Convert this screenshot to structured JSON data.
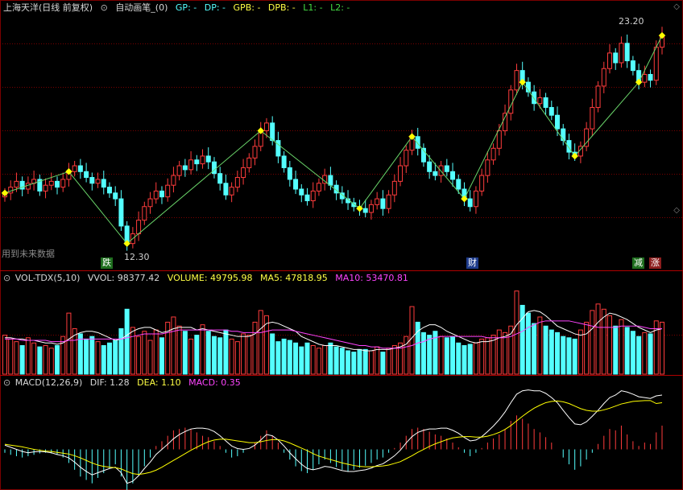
{
  "header": {
    "title": "上海天洋(日线 前复权)",
    "indicator": "自动画笔_(0)",
    "gp": "GP: -",
    "dp": "DP: -",
    "gpb": "GPB: -",
    "dpb": "DPB: -",
    "l1": "L1: -",
    "l2": "L2: -"
  },
  "price_panel": {
    "high_label": "23.20",
    "low_label": "12.30",
    "future_note": "用到未来数据",
    "markers": [
      {
        "text": "跌",
        "bg": "#1e6e1e"
      },
      {
        "text": "财",
        "bg": "#1e3c8c"
      },
      {
        "text": "减",
        "bg": "#1e6e1e"
      },
      {
        "text": "涨",
        "bg": "#8c1e1e"
      }
    ]
  },
  "volume_panel": {
    "name": "VOL-TDX(5,10)",
    "vvol": "VVOL: 98377.42",
    "volume": "VOLUME: 49795.98",
    "ma5": "MA5: 47818.95",
    "ma10": "MA10: 53470.81"
  },
  "macd_panel": {
    "name": "MACD(12,26,9)",
    "dif": "DIF: 1.28",
    "dea": "DEA: 1.10",
    "macd": "MACD: 0.35"
  },
  "colors": {
    "up": "#ff3c3c",
    "down": "#54ffff",
    "zigzag": "#6ad56a",
    "pivot": "#ffff00",
    "ma5": "#ffffff",
    "ma10": "#ff44ff",
    "dif": "#ffffff",
    "dea": "#ffff00",
    "grid": "#7a0000"
  },
  "chart_data": [
    {
      "type": "candlestick",
      "title": "上海天洋(日线 前复权)",
      "ylim": [
        11.5,
        24.0
      ],
      "closes": [
        14.9,
        15.2,
        15.5,
        15.1,
        15.4,
        15.6,
        15.0,
        15.3,
        15.5,
        15.2,
        15.6,
        16.0,
        16.3,
        16.0,
        15.7,
        15.4,
        15.6,
        15.2,
        14.9,
        14.6,
        13.2,
        12.3,
        12.8,
        13.5,
        14.2,
        14.6,
        15.0,
        14.7,
        15.3,
        15.8,
        16.3,
        16.1,
        16.6,
        16.4,
        16.8,
        16.5,
        15.9,
        15.4,
        14.8,
        15.2,
        15.7,
        16.2,
        16.7,
        17.3,
        18.1,
        18.5,
        17.6,
        16.8,
        16.2,
        15.6,
        15.1,
        14.8,
        14.5,
        15.0,
        15.4,
        15.8,
        15.3,
        14.9,
        14.6,
        14.4,
        14.2,
        14.1,
        13.9,
        14.3,
        14.6,
        14.1,
        14.8,
        15.5,
        16.3,
        17.1,
        17.8,
        17.2,
        16.5,
        16.0,
        15.8,
        16.3,
        16.0,
        15.6,
        15.1,
        14.6,
        14.2,
        15.0,
        15.8,
        16.6,
        17.2,
        18.1,
        19.0,
        20.2,
        21.2,
        20.6,
        20.1,
        19.5,
        19.8,
        19.3,
        18.9,
        18.2,
        17.6,
        17.0,
        16.8,
        17.3,
        18.2,
        19.3,
        20.4,
        21.3,
        22.1,
        21.6,
        22.6,
        21.7,
        21.2,
        20.6,
        21.0,
        20.7,
        22.4,
        23.0
      ],
      "high": 23.2,
      "low": 12.3
    },
    {
      "type": "bar",
      "title": "VOL-TDX(5,10)",
      "series": [
        {
          "name": "VOLUME",
          "values": [
            30,
            27,
            25,
            22,
            28,
            24,
            21,
            22,
            20,
            22,
            29,
            47,
            35,
            31,
            27,
            29,
            25,
            22,
            24,
            26,
            35,
            50,
            36,
            29,
            33,
            26,
            34,
            28,
            40,
            44,
            37,
            33,
            27,
            30,
            38,
            33,
            29,
            28,
            34,
            27,
            25,
            31,
            30,
            40,
            49,
            45,
            31,
            25,
            27,
            26,
            24,
            21,
            24,
            22,
            20,
            22,
            24,
            21,
            20,
            18,
            17,
            19,
            19,
            18,
            21,
            17,
            20,
            22,
            24,
            29,
            52,
            40,
            32,
            30,
            33,
            29,
            28,
            29,
            24,
            22,
            23,
            24,
            27,
            28,
            30,
            34,
            32,
            37,
            64,
            53,
            47,
            39,
            44,
            37,
            34,
            32,
            29,
            28,
            27,
            34,
            40,
            49,
            54,
            50,
            45,
            37,
            42,
            36,
            33,
            29,
            32,
            31,
            41,
            40
          ]
        },
        {
          "name": "MA5",
          "values": [
            28,
            28,
            27,
            27,
            26,
            26,
            25,
            24,
            24,
            23,
            24,
            27,
            30,
            32,
            33,
            33,
            32,
            30,
            28,
            26,
            27,
            30,
            33,
            35,
            36,
            36,
            34,
            32,
            33,
            35,
            36,
            36,
            36,
            34,
            35,
            34,
            33,
            32,
            31,
            30,
            29,
            29,
            29,
            31,
            35,
            39,
            40,
            39,
            37,
            35,
            33,
            29,
            27,
            25,
            23,
            22,
            22,
            22,
            21,
            20,
            19,
            19,
            18,
            18,
            19,
            19,
            19,
            20,
            21,
            23,
            28,
            33,
            36,
            38,
            38,
            36,
            33,
            31,
            29,
            27,
            25,
            24,
            25,
            25,
            26,
            28,
            29,
            31,
            38,
            43,
            48,
            49,
            48,
            45,
            41,
            37,
            35,
            33,
            31,
            30,
            31,
            35,
            40,
            44,
            47,
            46,
            44,
            42,
            39,
            36,
            34,
            32,
            34,
            35
          ]
        },
        {
          "name": "MA10",
          "values": [
            27,
            27,
            27,
            26,
            26,
            26,
            26,
            26,
            25,
            25,
            25,
            26,
            26,
            27,
            27,
            27,
            27,
            27,
            27,
            27,
            27,
            28,
            29,
            30,
            31,
            31,
            31,
            31,
            32,
            33,
            34,
            34,
            34,
            34,
            34,
            34,
            34,
            34,
            34,
            33,
            33,
            32,
            32,
            32,
            32,
            33,
            34,
            34,
            34,
            34,
            33,
            32,
            31,
            30,
            29,
            28,
            27,
            26,
            25,
            24,
            23,
            22,
            22,
            21,
            21,
            20,
            20,
            20,
            20,
            21,
            22,
            24,
            25,
            27,
            28,
            29,
            29,
            29,
            29,
            29,
            29,
            29,
            29,
            28,
            28,
            28,
            28,
            29,
            31,
            33,
            36,
            38,
            40,
            41,
            41,
            41,
            41,
            41,
            40,
            39,
            38,
            37,
            36,
            36,
            36,
            36,
            37,
            37,
            37,
            37,
            36,
            35,
            35,
            35
          ]
        }
      ]
    },
    {
      "type": "bar",
      "title": "MACD(12,26,9)",
      "series": [
        {
          "name": "MACD",
          "values": [
            -0.05,
            -0.08,
            -0.1,
            -0.12,
            -0.1,
            -0.08,
            -0.06,
            -0.05,
            -0.06,
            -0.08,
            -0.12,
            -0.2,
            -0.3,
            -0.4,
            -0.45,
            -0.5,
            -0.42,
            -0.35,
            -0.28,
            -0.22,
            -0.4,
            -0.6,
            -0.5,
            -0.38,
            -0.25,
            -0.12,
            0.05,
            0.12,
            0.2,
            0.28,
            0.3,
            0.32,
            0.3,
            0.25,
            0.2,
            0.18,
            0.12,
            0.05,
            -0.05,
            -0.12,
            -0.1,
            -0.05,
            0.0,
            0.1,
            0.2,
            0.28,
            0.2,
            0.1,
            -0.05,
            -0.15,
            -0.25,
            -0.32,
            -0.35,
            -0.3,
            -0.22,
            -0.15,
            -0.2,
            -0.26,
            -0.3,
            -0.32,
            -0.3,
            -0.27,
            -0.24,
            -0.2,
            -0.15,
            -0.12,
            -0.05,
            0.02,
            0.1,
            0.2,
            0.3,
            0.32,
            0.3,
            0.26,
            0.22,
            0.2,
            0.16,
            0.1,
            0.03,
            -0.05,
            -0.1,
            -0.05,
            0.02,
            0.1,
            0.16,
            0.22,
            0.3,
            0.42,
            0.5,
            0.45,
            0.38,
            0.3,
            0.25,
            0.18,
            0.1,
            0.0,
            -0.12,
            -0.22,
            -0.3,
            -0.25,
            -0.15,
            -0.05,
            0.08,
            0.2,
            0.3,
            0.28,
            0.35,
            0.22,
            0.12,
            0.05,
            0.1,
            0.08,
            0.25,
            0.35
          ]
        },
        {
          "name": "DIF",
          "values": [
            0.1,
            0.05,
            0.0,
            -0.05,
            -0.08,
            -0.06,
            -0.05,
            -0.06,
            -0.08,
            -0.12,
            -0.15,
            -0.2,
            -0.3,
            -0.42,
            -0.52,
            -0.6,
            -0.55,
            -0.5,
            -0.45,
            -0.42,
            -0.55,
            -0.8,
            -0.75,
            -0.62,
            -0.45,
            -0.3,
            -0.12,
            0.0,
            0.12,
            0.25,
            0.35,
            0.42,
            0.48,
            0.5,
            0.5,
            0.48,
            0.42,
            0.32,
            0.2,
            0.08,
            0.02,
            0.0,
            0.02,
            0.1,
            0.22,
            0.35,
            0.32,
            0.22,
            0.08,
            -0.08,
            -0.22,
            -0.35,
            -0.45,
            -0.48,
            -0.45,
            -0.4,
            -0.42,
            -0.46,
            -0.5,
            -0.52,
            -0.52,
            -0.5,
            -0.48,
            -0.44,
            -0.38,
            -0.34,
            -0.25,
            -0.15,
            -0.02,
            0.15,
            0.3,
            0.4,
            0.45,
            0.48,
            0.48,
            0.5,
            0.5,
            0.45,
            0.38,
            0.28,
            0.2,
            0.22,
            0.3,
            0.42,
            0.55,
            0.7,
            0.88,
            1.1,
            1.3,
            1.38,
            1.4,
            1.38,
            1.38,
            1.32,
            1.22,
            1.1,
            0.92,
            0.75,
            0.6,
            0.58,
            0.65,
            0.78,
            0.92,
            1.08,
            1.22,
            1.28,
            1.38,
            1.35,
            1.3,
            1.24,
            1.22,
            1.2,
            1.26,
            1.28
          ]
        },
        {
          "name": "DEA",
          "values": [
            0.12,
            0.1,
            0.08,
            0.06,
            0.03,
            0.0,
            -0.02,
            -0.04,
            -0.05,
            -0.07,
            -0.09,
            -0.11,
            -0.15,
            -0.2,
            -0.26,
            -0.32,
            -0.37,
            -0.4,
            -0.42,
            -0.43,
            -0.46,
            -0.52,
            -0.57,
            -0.59,
            -0.57,
            -0.54,
            -0.49,
            -0.42,
            -0.34,
            -0.26,
            -0.18,
            -0.1,
            -0.02,
            0.05,
            0.12,
            0.18,
            0.22,
            0.24,
            0.24,
            0.22,
            0.2,
            0.18,
            0.16,
            0.16,
            0.18,
            0.21,
            0.23,
            0.23,
            0.2,
            0.15,
            0.09,
            0.03,
            -0.03,
            -0.1,
            -0.16,
            -0.2,
            -0.24,
            -0.28,
            -0.32,
            -0.35,
            -0.38,
            -0.4,
            -0.41,
            -0.41,
            -0.4,
            -0.39,
            -0.37,
            -0.33,
            -0.29,
            -0.22,
            -0.15,
            -0.07,
            0.0,
            0.07,
            0.13,
            0.18,
            0.23,
            0.27,
            0.29,
            0.3,
            0.3,
            0.29,
            0.29,
            0.31,
            0.35,
            0.4,
            0.47,
            0.56,
            0.67,
            0.78,
            0.88,
            0.97,
            1.04,
            1.1,
            1.13,
            1.14,
            1.12,
            1.08,
            1.02,
            0.96,
            0.92,
            0.9,
            0.9,
            0.93,
            0.97,
            1.02,
            1.07,
            1.1,
            1.13,
            1.14,
            1.15,
            1.15,
            1.08,
            1.1
          ]
        }
      ]
    }
  ]
}
